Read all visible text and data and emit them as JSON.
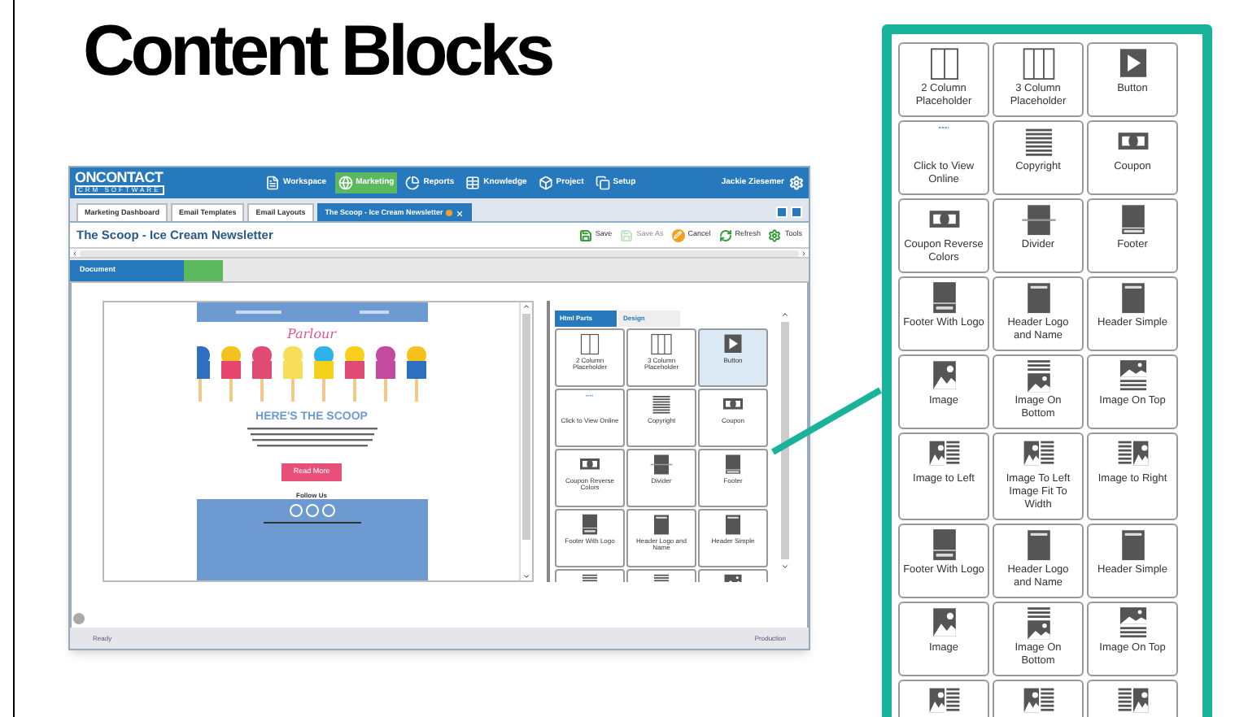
{
  "title": "Content Blocks",
  "app": {
    "logo": {
      "name": "ONCONTACT",
      "sub": "CRM SOFTWARE"
    },
    "nav": [
      {
        "label": "Workspace",
        "selected": false
      },
      {
        "label": "Marketing",
        "selected": true
      },
      {
        "label": "Reports",
        "selected": false
      },
      {
        "label": "Knowledge",
        "selected": false
      },
      {
        "label": "Project",
        "selected": false
      },
      {
        "label": "Setup",
        "selected": false
      }
    ],
    "user": "Jackie Ziesemer",
    "tabs": [
      {
        "label": "Marketing Dashboard",
        "selected": false
      },
      {
        "label": "Email Templates",
        "selected": false
      },
      {
        "label": "Email Layouts",
        "selected": false
      },
      {
        "label": "The Scoop - Ice Cream Newsletter",
        "selected": true
      }
    ],
    "page_title": "The Scoop - Ice Cream Newsletter",
    "actions": [
      {
        "label": "Save",
        "disabled": false
      },
      {
        "label": "Save As",
        "disabled": true
      },
      {
        "label": "Cancel",
        "disabled": false
      },
      {
        "label": "Refresh",
        "disabled": false
      },
      {
        "label": "Tools",
        "disabled": false
      }
    ],
    "doc_tabs": [
      {
        "label": "Document",
        "selected": true
      },
      {
        "selected": false
      }
    ],
    "email": {
      "brand": "Parlour",
      "heading": "HERE'S THE SCOOP",
      "button": "Read More",
      "follow": "Follow Us"
    },
    "palette_tabs": [
      {
        "label": "Html Parts",
        "selected": true
      },
      {
        "label": "Design",
        "selected": false
      }
    ],
    "blocks": [
      {
        "label": "2 Column Placeholder",
        "kind": "col2",
        "selected": false
      },
      {
        "label": "3 Column Placeholder",
        "kind": "col3",
        "selected": false
      },
      {
        "label": "Button",
        "kind": "play",
        "selected": true
      },
      {
        "label": "Click to View Online",
        "kind": "blank",
        "selected": false
      },
      {
        "label": "Copyright",
        "kind": "lines",
        "selected": false
      },
      {
        "label": "Coupon",
        "kind": "coupon",
        "selected": false
      },
      {
        "label": "Coupon Reverse Colors",
        "kind": "coupon",
        "selected": false
      },
      {
        "label": "Divider",
        "kind": "divider",
        "selected": false
      },
      {
        "label": "Footer",
        "kind": "footer",
        "selected": false
      },
      {
        "label": "Footer With Logo",
        "kind": "footerlogo",
        "selected": false
      },
      {
        "label": "Header Logo and Name",
        "kind": "header",
        "selected": false
      },
      {
        "label": "Header Simple",
        "kind": "header",
        "selected": false
      },
      {
        "kind": "imagebottom",
        "selected": false
      },
      {
        "kind": "imagebottom",
        "selected": false
      },
      {
        "kind": "imagetop",
        "selected": false
      }
    ],
    "status": [
      "Ready",
      "Production"
    ]
  },
  "zoom_blocks": [
    {
      "label": "2 Column Placeholder",
      "kind": "col2"
    },
    {
      "label": "3 Column Placeholder",
      "kind": "col3"
    },
    {
      "label": "Button",
      "kind": "play"
    },
    {
      "label": "Click to View Online",
      "kind": "blank"
    },
    {
      "label": "Copyright",
      "kind": "lines"
    },
    {
      "label": "Coupon",
      "kind": "coupon"
    },
    {
      "label": "Coupon Reverse Colors",
      "kind": "coupon"
    },
    {
      "label": "Divider",
      "kind": "divider"
    },
    {
      "label": "Footer",
      "kind": "footer"
    },
    {
      "label": "Footer With Logo",
      "kind": "footerlogo"
    },
    {
      "label": "Header Logo and Name",
      "kind": "header"
    },
    {
      "label": "Header Simple",
      "kind": "header"
    },
    {
      "label": "Image",
      "kind": "image"
    },
    {
      "label": "Image On Bottom",
      "kind": "imagebottom"
    },
    {
      "label": "Image On Top",
      "kind": "imagetop"
    },
    {
      "label": "Image to Left",
      "kind": "imageleft"
    },
    {
      "label": "Image To Left Image Fit To Width",
      "kind": "imageleft"
    },
    {
      "label": "Image to Right",
      "kind": "imageright"
    },
    {
      "label": "Footer With Logo",
      "kind": "footerlogo"
    },
    {
      "label": "Header Logo and Name",
      "kind": "header"
    },
    {
      "label": "Header Simple",
      "kind": "header"
    },
    {
      "label": "Image",
      "kind": "image"
    },
    {
      "label": "Image On Bottom",
      "kind": "imagebottom"
    },
    {
      "label": "Image On Top",
      "kind": "imagetop"
    },
    {
      "kind": "imageleft"
    },
    {
      "kind": "imageleft"
    },
    {
      "kind": "imageright"
    }
  ]
}
